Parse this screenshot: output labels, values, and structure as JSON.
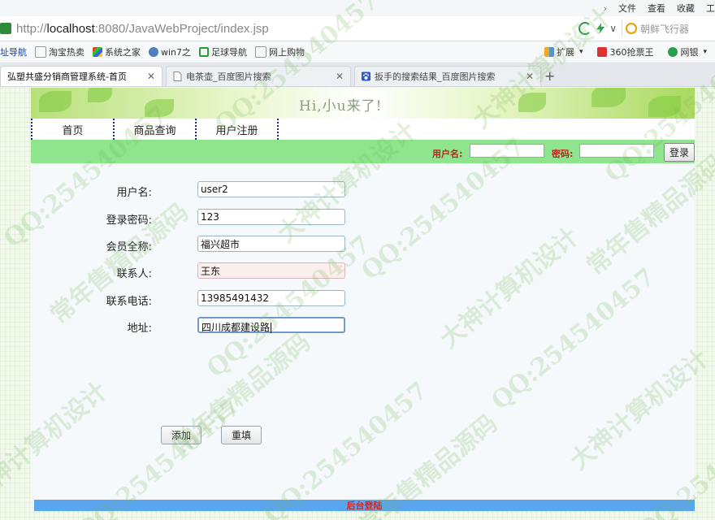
{
  "browser": {
    "menus": [
      "文件",
      "查看",
      "收藏",
      "工"
    ],
    "url_prefix": "http://",
    "url_host": "localhost",
    "url_rest": ":8080/JavaWebProject/index.jsp",
    "search_placeholder": "朝鲜飞行器",
    "bookmarks": [
      "址导航",
      "淘宝热卖",
      "系统之家",
      "win7之",
      "足球导航",
      "网上购物"
    ],
    "bookmarks_right": [
      "扩展",
      "360抢票王",
      "网银"
    ],
    "tabs": [
      {
        "title": "弘塑共盛分销商管理系统-首页",
        "active": true
      },
      {
        "title": "电茶壶_百度图片搜索",
        "active": false
      },
      {
        "title": "扳手的搜索结果_百度图片搜索",
        "active": false
      }
    ],
    "new_tab": "+"
  },
  "banner": {
    "greeting": "Hi,小u来了!"
  },
  "nav": [
    "首页",
    "商品查询",
    "用户注册"
  ],
  "login": {
    "username_label": "用户名:",
    "password_label": "密码:",
    "button": "登录"
  },
  "form": {
    "fields": [
      {
        "label": "用户名:",
        "value": "user2"
      },
      {
        "label": "登录密码:",
        "value": "123"
      },
      {
        "label": "会员全称:",
        "value": "福兴超市"
      },
      {
        "label": "联系人:",
        "value": "王东"
      },
      {
        "label": "联系电话:",
        "value": "13985491432"
      },
      {
        "label": "地址:",
        "value": "四川成都建设路"
      }
    ],
    "add_button": "添加",
    "reset_button": "重填"
  },
  "footer": {
    "admin_link": "后台登陆"
  },
  "watermark": [
    "QQ:254540457",
    "大神计算机设计",
    "常年售精品源码"
  ]
}
